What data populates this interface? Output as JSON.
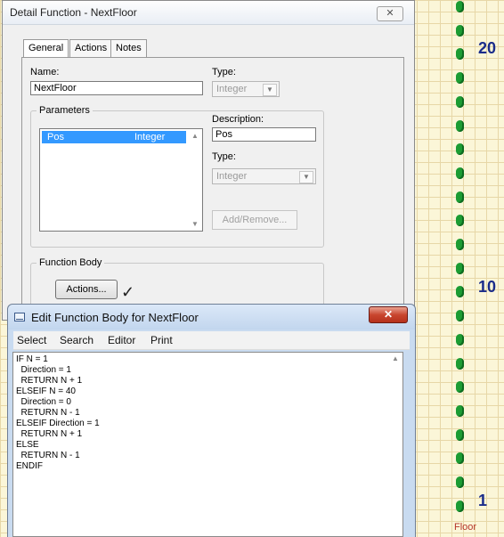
{
  "detail_dialog": {
    "title": "Detail Function - NextFloor",
    "close_glyph": "✕",
    "tabs": [
      "General",
      "Actions",
      "Notes"
    ],
    "name_label": "Name:",
    "name_value": "NextFloor",
    "type_label": "Type:",
    "type_value": "Integer",
    "parameters_group": "Parameters",
    "param_row": {
      "name": "Pos",
      "type": "Integer"
    },
    "description_label": "Description:",
    "description_value": "Pos",
    "param_type_label": "Type:",
    "param_type_value": "Integer",
    "add_remove_label": "Add/Remove...",
    "function_body_group": "Function Body",
    "actions_button": "Actions...",
    "checkmark": "✓"
  },
  "edit_window": {
    "title": "Edit Function Body for NextFloor",
    "close_glyph": "✕",
    "menu": [
      "Select",
      "Search",
      "Editor",
      "Print"
    ],
    "code": [
      "IF N = 1",
      "  Direction = 1",
      "  RETURN N + 1",
      "ELSEIF N = 40",
      "  Direction = 0",
      "  RETURN N - 1",
      "ELSEIF Direction = 1",
      "  RETURN N + 1",
      "ELSE",
      "  RETURN N - 1",
      "ENDIF"
    ]
  },
  "floor_panel": {
    "labels": [
      "20",
      "10",
      "1"
    ],
    "axis_label": "Floor",
    "dot_color": "#1c9c33",
    "number_color": "#1a2c8a"
  }
}
